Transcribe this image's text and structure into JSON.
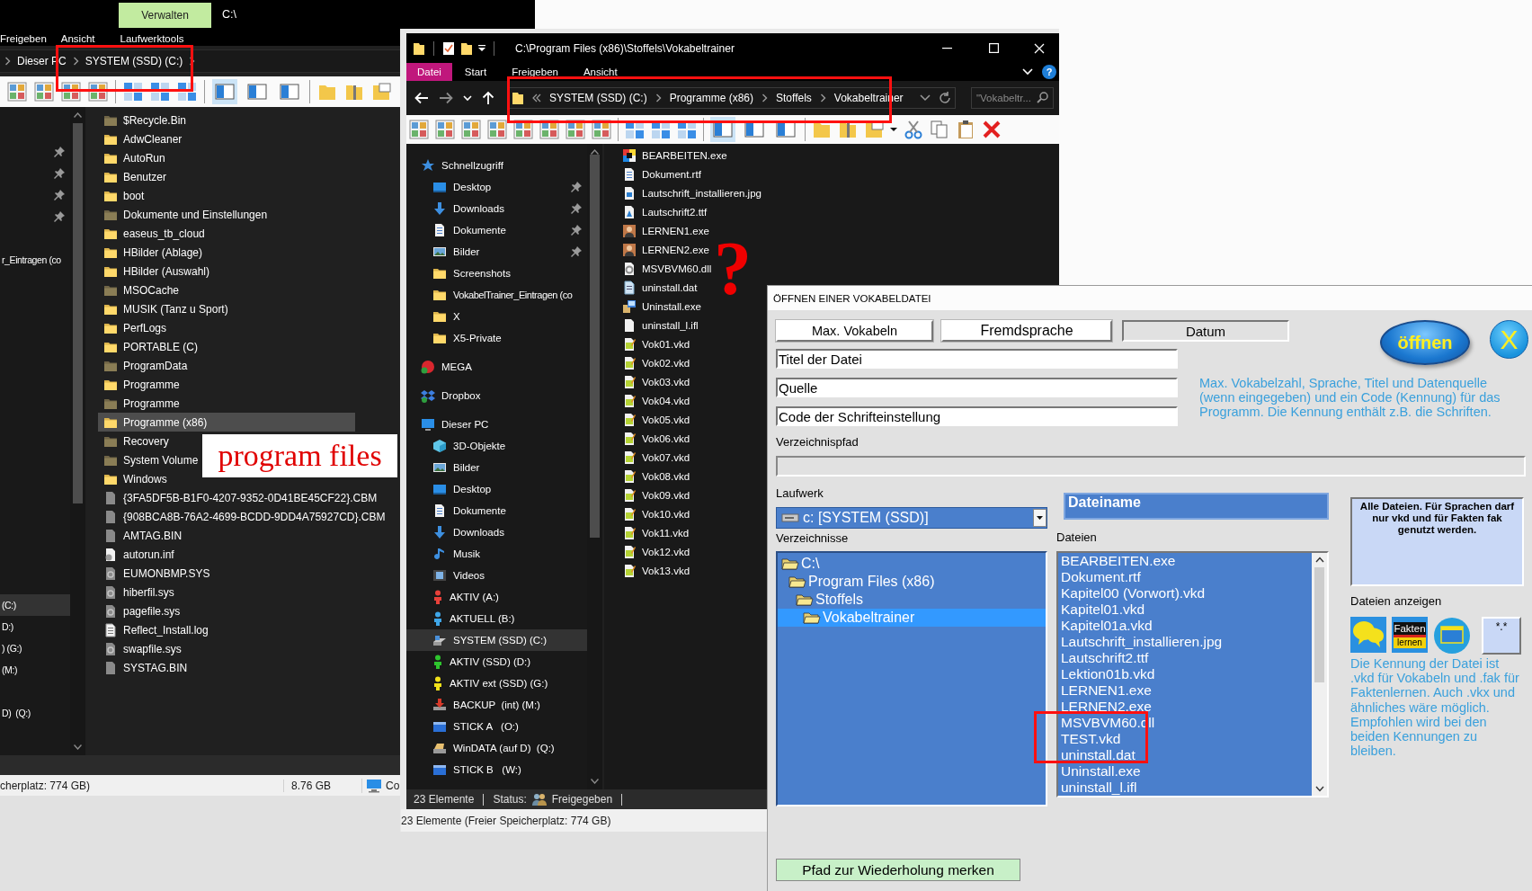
{
  "left_window": {
    "context_tab": "Verwalten",
    "title": "C:\\",
    "ribbon_tabs": [
      {
        "label": "Freigeben"
      },
      {
        "label": "Ansicht"
      },
      {
        "label": "Laufwerktools"
      }
    ],
    "breadcrumb": [
      "Dieser PC",
      "SYSTEM (SSD) (C:)"
    ],
    "pane_buttons": [
      {
        "on": true
      },
      {
        "on": false
      },
      {
        "on": false
      }
    ],
    "nav_items": [
      {
        "pinned": true,
        "selected": false
      },
      {
        "pinned": true,
        "selected": false
      },
      {
        "pinned": true,
        "selected": false
      },
      {
        "pinned": true,
        "selected": false
      },
      {
        "label": "r_Eintragen (co",
        "pinned": false,
        "selected": false
      },
      {
        "label": "(C:)",
        "pinned": false,
        "selected": true
      },
      {
        "label": "D:)",
        "pinned": false,
        "selected": false
      },
      {
        "label": ") (G:)",
        "pinned": false,
        "selected": false
      },
      {
        "label": "(M:)",
        "pinned": false,
        "selected": false
      },
      {
        "label": "D)  (Q:)",
        "pinned": false,
        "selected": false
      }
    ],
    "files": [
      {
        "name": "$Recycle.Bin",
        "kind": "folder_hidden",
        "selected": false
      },
      {
        "name": "AdwCleaner",
        "kind": "folder",
        "selected": false
      },
      {
        "name": "AutoRun",
        "kind": "folder",
        "selected": false
      },
      {
        "name": "Benutzer",
        "kind": "folder",
        "selected": false
      },
      {
        "name": "boot",
        "kind": "folder",
        "selected": false
      },
      {
        "name": "Dokumente und Einstellungen",
        "kind": "folder_hidden",
        "selected": false
      },
      {
        "name": "easeus_tb_cloud",
        "kind": "folder",
        "selected": false
      },
      {
        "name": "HBilder (Ablage)",
        "kind": "folder",
        "selected": false
      },
      {
        "name": "HBilder (Auswahl)",
        "kind": "folder",
        "selected": false
      },
      {
        "name": "MSOCache",
        "kind": "folder_hidden",
        "selected": false
      },
      {
        "name": "MUSIK (Tanz u Sport)",
        "kind": "folder",
        "selected": false
      },
      {
        "name": "PerfLogs",
        "kind": "folder",
        "selected": false
      },
      {
        "name": "PORTABLE (C)",
        "kind": "folder",
        "selected": false
      },
      {
        "name": "ProgramData",
        "kind": "folder_hidden",
        "selected": false
      },
      {
        "name": "Programme",
        "kind": "folder",
        "selected": false
      },
      {
        "name": "Programme",
        "kind": "folder_hidden",
        "selected": false
      },
      {
        "name": "Programme (x86)",
        "kind": "folder",
        "selected": true
      },
      {
        "name": "Recovery",
        "kind": "folder_hidden",
        "selected": false
      },
      {
        "name": "System Volume",
        "kind": "folder_hidden",
        "selected": false
      },
      {
        "name": "Windows",
        "kind": "folder",
        "selected": false
      },
      {
        "name": "{3FA5DF5B-B1F0-4207-9352-0D41BE45CF22}.CBM",
        "kind": "file",
        "selected": false
      },
      {
        "name": "{908BCA8B-76A2-4699-BCDD-9DD4A75927CD}.CBM",
        "kind": "file",
        "selected": false
      },
      {
        "name": "AMTAG.BIN",
        "kind": "file",
        "selected": false
      },
      {
        "name": "autorun.inf",
        "kind": "inf",
        "selected": false
      },
      {
        "name": "EUMONBMP.SYS",
        "kind": "system",
        "selected": false
      },
      {
        "name": "hiberfil.sys",
        "kind": "system",
        "selected": false
      },
      {
        "name": "pagefile.sys",
        "kind": "system",
        "selected": false
      },
      {
        "name": "Reflect_Install.log",
        "kind": "log",
        "selected": false
      },
      {
        "name": "swapfile.sys",
        "kind": "system",
        "selected": false
      },
      {
        "name": "SYSTAG.BIN",
        "kind": "file",
        "selected": false
      }
    ],
    "status": {
      "free_space": "cherplatz: 774 GB)",
      "size": "8.76 GB",
      "computer": "Co"
    }
  },
  "middle_window": {
    "title": "C:\\Program Files (x86)\\Stoffels\\Vokabeltrainer",
    "ribbon_tabs": [
      {
        "label": "Datei",
        "kind": "menu"
      },
      {
        "label": "Start",
        "kind": "tab"
      },
      {
        "label": "Freigeben",
        "kind": "tab"
      },
      {
        "label": "Ansicht",
        "kind": "tab"
      }
    ],
    "help_button": "?",
    "breadcrumb": [
      "SYSTEM (SSD) (C:)",
      "Programme (x86)",
      "Stoffels",
      "Vokabeltrainer"
    ],
    "search": {
      "placeholder": "\"Vokabeltr..."
    },
    "pane_buttons": [
      {
        "on": true
      },
      {
        "on": false
      },
      {
        "on": false
      }
    ],
    "nav": [
      {
        "label": "Schnellzugriff",
        "kind": "star",
        "pinned": false,
        "selected": false,
        "children": [
          {
            "label": "Desktop",
            "kind": "desktop",
            "pinned": true,
            "selected": false
          },
          {
            "label": "Downloads",
            "kind": "download",
            "pinned": true,
            "selected": false
          },
          {
            "label": "Dokumente",
            "kind": "document",
            "pinned": true,
            "selected": false
          },
          {
            "label": "Bilder",
            "kind": "picture",
            "pinned": true,
            "selected": false
          },
          {
            "label": "Screenshots",
            "kind": "folder",
            "pinned": false,
            "selected": false
          },
          {
            "label": "VokabelTrainer_Eintragen (co",
            "kind": "folder",
            "pinned": false,
            "selected": false
          },
          {
            "label": "X",
            "kind": "folder",
            "pinned": false,
            "selected": false
          },
          {
            "label": "X5-Private",
            "kind": "folder",
            "pinned": false,
            "selected": false
          }
        ]
      },
      {
        "label": "MEGA",
        "kind": "mega",
        "pinned": false,
        "selected": false
      },
      {
        "label": "Dropbox",
        "kind": "dropbox",
        "pinned": false,
        "selected": false
      },
      {
        "label": "Dieser PC",
        "kind": "pc",
        "pinned": false,
        "selected": false,
        "children": [
          {
            "label": "3D-Objekte",
            "kind": "cube",
            "pinned": false,
            "selected": false
          },
          {
            "label": "Bilder",
            "kind": "picture",
            "pinned": false,
            "selected": false
          },
          {
            "label": "Desktop",
            "kind": "desktop",
            "pinned": false,
            "selected": false
          },
          {
            "label": "Dokumente",
            "kind": "document",
            "pinned": false,
            "selected": false
          },
          {
            "label": "Downloads",
            "kind": "download",
            "pinned": false,
            "selected": false
          },
          {
            "label": "Musik",
            "kind": "music",
            "pinned": false,
            "selected": false
          },
          {
            "label": "Videos",
            "kind": "video",
            "pinned": false,
            "selected": false
          },
          {
            "label": "AKTIV (A:)",
            "kind": "person",
            "color": "#e8413a",
            "pinned": false,
            "selected": false
          },
          {
            "label": "AKTUELL (B:)",
            "kind": "person",
            "color": "#3fa6e8",
            "pinned": false,
            "selected": false
          },
          {
            "label": "SYSTEM (SSD) (C:)",
            "kind": "drive_system",
            "pinned": false,
            "selected": true
          },
          {
            "label": "AKTIV (SSD) (D:)",
            "kind": "person",
            "color": "#2ec52e",
            "pinned": false,
            "selected": false
          },
          {
            "label": "AKTIV ext (SSD) (G:)",
            "kind": "person",
            "color": "#f2e21a",
            "pinned": false,
            "selected": false
          },
          {
            "label": "BACKUP  (int) (M:)",
            "kind": "backup",
            "pinned": false,
            "selected": false
          },
          {
            "label": "STICK A   (O:)",
            "kind": "usb",
            "pinned": false,
            "selected": false
          },
          {
            "label": "WinDATA (auf D)  (Q:)",
            "kind": "drive",
            "pinned": false,
            "selected": false
          },
          {
            "label": "STICK B   (W:)",
            "kind": "usb",
            "pinned": false,
            "selected": false
          }
        ]
      }
    ],
    "files": [
      {
        "name": "BEARBEITEN.exe",
        "kind": "app",
        "selected": false
      },
      {
        "name": "Dokument.rtf",
        "kind": "document",
        "selected": false
      },
      {
        "name": "Lautschrift_installieren.jpg",
        "kind": "image",
        "selected": false
      },
      {
        "name": "Lautschrift2.ttf",
        "kind": "font",
        "selected": false
      },
      {
        "name": "LERNEN1.exe",
        "kind": "program",
        "selected": false
      },
      {
        "name": "LERNEN2.exe",
        "kind": "program",
        "selected": false
      },
      {
        "name": "MSVBVM60.dll",
        "kind": "library",
        "selected": false
      },
      {
        "name": "uninstall.dat",
        "kind": "notes",
        "selected": false
      },
      {
        "name": "Uninstall.exe",
        "kind": "installer",
        "selected": false
      },
      {
        "name": "uninstall_l.ifl",
        "kind": "file_white",
        "selected": false
      },
      {
        "name": "Vok01.vkd",
        "kind": "vocab",
        "selected": false
      },
      {
        "name": "Vok02.vkd",
        "kind": "vocab",
        "selected": false
      },
      {
        "name": "Vok03.vkd",
        "kind": "vocab",
        "selected": false
      },
      {
        "name": "Vok04.vkd",
        "kind": "vocab",
        "selected": false
      },
      {
        "name": "Vok05.vkd",
        "kind": "vocab",
        "selected": false
      },
      {
        "name": "Vok06.vkd",
        "kind": "vocab",
        "selected": false
      },
      {
        "name": "Vok07.vkd",
        "kind": "vocab",
        "selected": false
      },
      {
        "name": "Vok08.vkd",
        "kind": "vocab",
        "selected": false
      },
      {
        "name": "Vok09.vkd",
        "kind": "vocab",
        "selected": false
      },
      {
        "name": "Vok10.vkd",
        "kind": "vocab",
        "selected": false
      },
      {
        "name": "Vok11.vkd",
        "kind": "vocab",
        "selected": false
      },
      {
        "name": "Vok12.vkd",
        "kind": "vocab",
        "selected": false
      },
      {
        "name": "Vok13.vkd",
        "kind": "vocab",
        "selected": false
      }
    ],
    "status": {
      "count": "23 Elemente",
      "status_label": "Status:",
      "status_value": "Freigegeben"
    },
    "free_space": "23 Elemente (Freier Speicherplatz: 774 GB)"
  },
  "dialog": {
    "title": "ÖFFNEN EINER VOKABELDATEI",
    "info_boxes": [
      {
        "value": "Max. Vokabeln",
        "kind": "raised"
      },
      {
        "value": "Fremdsprache",
        "kind": "raised"
      },
      {
        "value": "Datum",
        "kind": "sunken"
      }
    ],
    "fields": [
      {
        "value": "Titel der Datei"
      },
      {
        "value": "Quelle"
      },
      {
        "value": "Code der Schrifteinstellung"
      }
    ],
    "open_button": "öffnen",
    "close_button": "X",
    "hint": "Max. Vokabelzahl, Sprache, Titel und Datenquelle (wenn eingegeben) und ein Code (Kennung) für das Programm. Die Kennung enthält z.B. die Schriften.",
    "path_label": "Verzeichnispfad",
    "drive_label": "Laufwerk",
    "drive": "c: [SYSTEM (SSD)]",
    "dirs_label": "Verzeichnisse",
    "dirs": [
      {
        "label": "C:\\",
        "selected": false,
        "children": [
          {
            "label": "Program Files (x86)",
            "selected": false,
            "children": [
              {
                "label": "Stoffels",
                "selected": false,
                "children": [
                  {
                    "label": "Vokabeltrainer",
                    "selected": true
                  }
                ]
              }
            ]
          }
        ]
      }
    ],
    "filename_header": "Dateiname",
    "files_label": "Dateien",
    "files": [
      {
        "name": "BEARBEITEN.exe",
        "selected": false
      },
      {
        "name": "Dokument.rtf",
        "selected": false
      },
      {
        "name": "Kapitel00 (Vorwort).vkd",
        "selected": false
      },
      {
        "name": "Kapitel01.vkd",
        "selected": false
      },
      {
        "name": "Kapitel01a.vkd",
        "selected": false
      },
      {
        "name": "Lautschrift_installieren.jpg",
        "selected": false
      },
      {
        "name": "Lautschrift2.ttf",
        "selected": false
      },
      {
        "name": "Lektion01b.vkd",
        "selected": false
      },
      {
        "name": "LERNEN1.exe",
        "selected": false
      },
      {
        "name": "LERNEN2.exe",
        "selected": false
      },
      {
        "name": "MSVBVM60.dll",
        "selected": false
      },
      {
        "name": "TEST.vkd",
        "selected": false
      },
      {
        "name": "uninstall.dat",
        "selected": false
      },
      {
        "name": "Uninstall.exe",
        "selected": false
      },
      {
        "name": "uninstall_l.ifl",
        "selected": false
      }
    ],
    "filter_note": "Alle Dateien. Für Sprachen darf nur vkd und für Fakten fak genutzt werden.",
    "show_files_label": "Dateien anzeigen",
    "fakten_button": [
      "Fakten",
      "lernen"
    ],
    "all_files_button": "*.*",
    "extension_note": "Die Kennung der Datei ist .vkd für Vokabeln und .fak für Faktenlernen. Auch .vkx und ähnliches wäre möglich. Empfohlen wird bei den beiden Kennungen zu bleiben.",
    "remember_button": "Pfad zur Wiederholung merken"
  },
  "annotations": {
    "label": "program files",
    "question_mark": "?"
  }
}
